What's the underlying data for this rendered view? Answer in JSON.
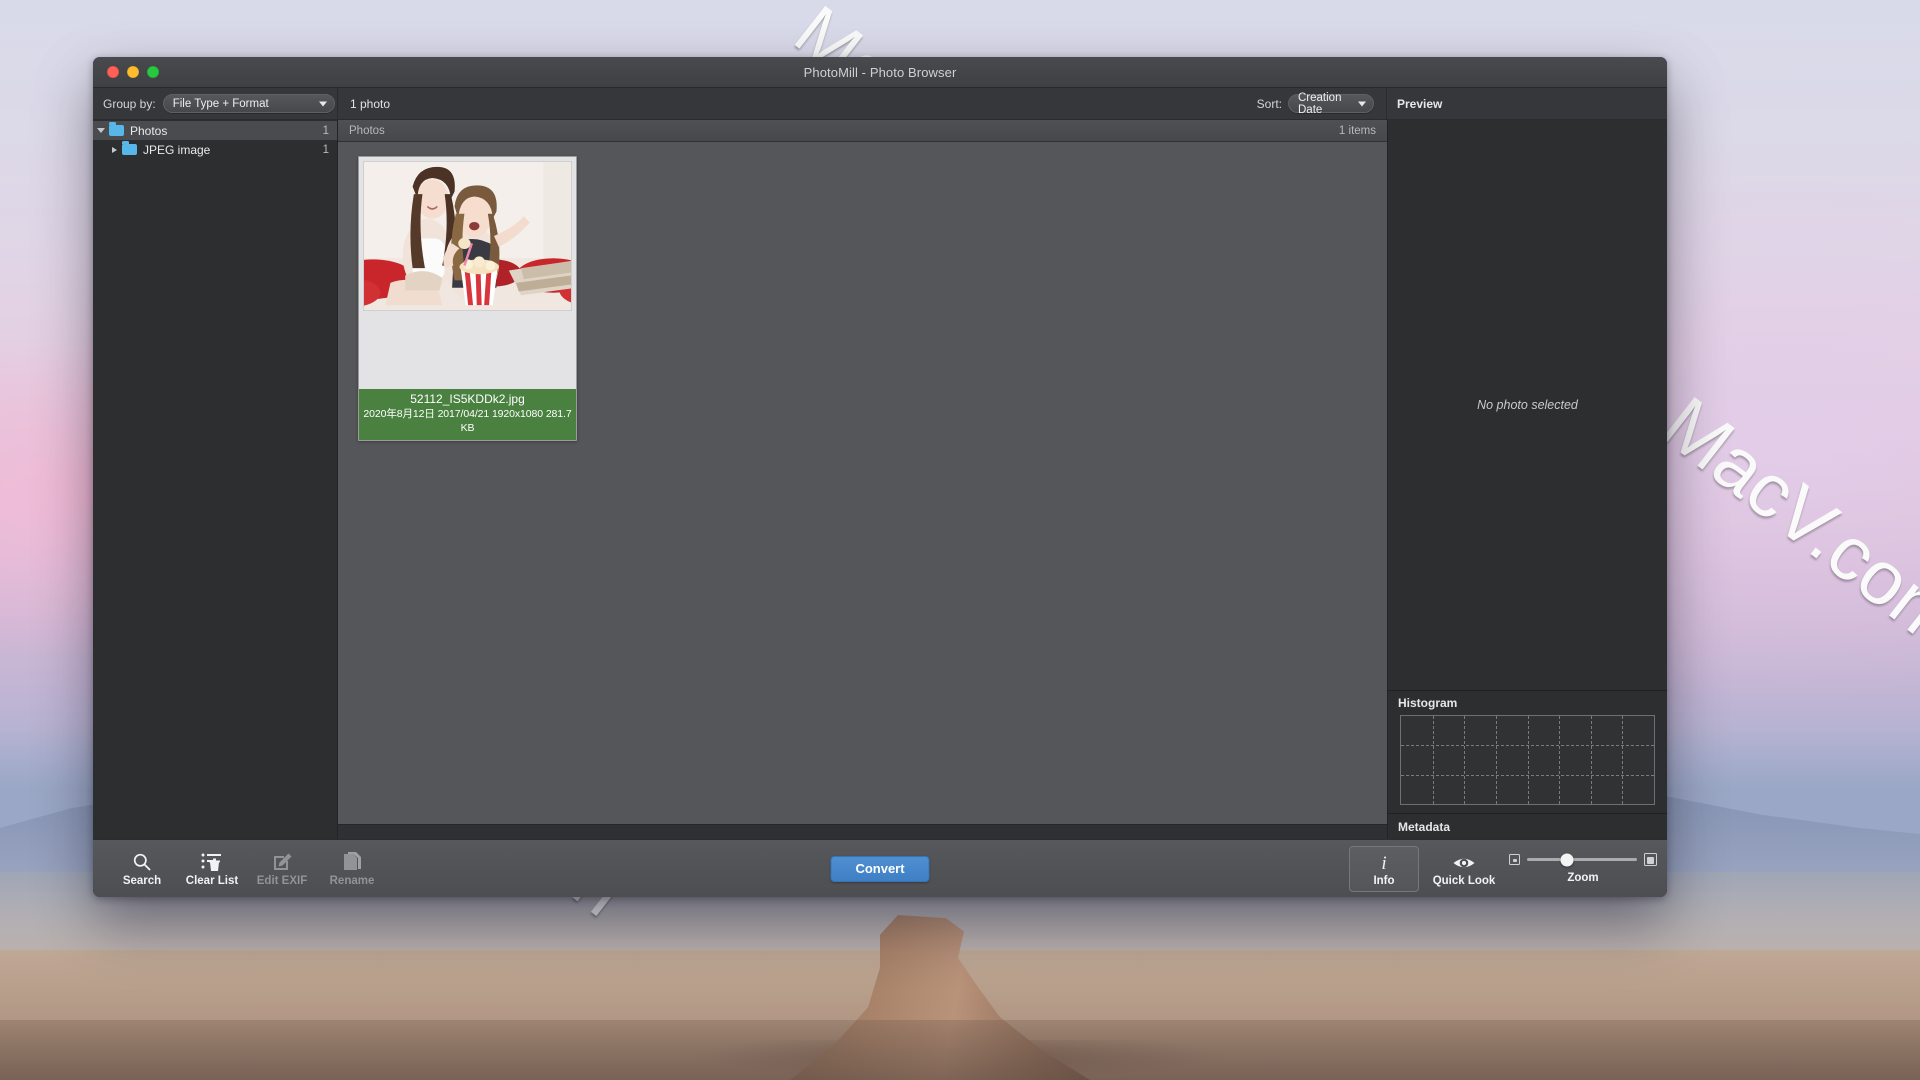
{
  "window": {
    "title": "PhotoMill - Photo Browser",
    "traffic_lights": [
      "close",
      "minimize",
      "zoom"
    ]
  },
  "toolbar_top": {
    "group_by_label": "Group by:",
    "group_by_value": "File Type + Format",
    "photo_count": "1 photo",
    "sort_label": "Sort:",
    "sort_value": "Creation Date",
    "preview_header": "Preview"
  },
  "sidebar": {
    "items": [
      {
        "label": "Photos",
        "count": "1",
        "level": 0,
        "expanded": true,
        "selected": true
      },
      {
        "label": "JPEG image",
        "count": "1",
        "level": 1,
        "expanded": false,
        "selected": false
      }
    ]
  },
  "content": {
    "header_left": "Photos",
    "header_right": "1 items",
    "thumbnails": [
      {
        "filename": "52112_IS5KDDk2.jpg",
        "meta_line": "2020年8月12日 2017/04/21  1920x1080  281.7 KB",
        "date_created": "2020年8月12日",
        "date_modified": "2017/04/21",
        "dimensions": "1920x1080",
        "filesize": "281.7 KB",
        "selected": true,
        "caption_color": "#4a8141"
      }
    ]
  },
  "inspector": {
    "preview_header": "Preview",
    "preview_empty_text": "No photo selected",
    "histogram_header": "Histogram",
    "histogram_columns": 8,
    "histogram_rows": 3,
    "metadata_header": "Metadata"
  },
  "toolbar_bottom": {
    "left_items": [
      {
        "label": "Search",
        "icon": "search-icon",
        "enabled": true
      },
      {
        "label": "Clear List",
        "icon": "clear-list-icon",
        "enabled": true
      },
      {
        "label": "Edit EXIF",
        "icon": "edit-exif-icon",
        "enabled": false
      },
      {
        "label": "Rename",
        "icon": "rename-icon",
        "enabled": false
      }
    ],
    "convert_label": "Convert",
    "right_items": [
      {
        "label": "Info",
        "icon": "info-icon",
        "active": true
      },
      {
        "label": "Quick Look",
        "icon": "eye-icon",
        "active": false
      }
    ],
    "zoom_label": "Zoom",
    "zoom_value": 36
  },
  "desktop": {
    "watermarks": [
      "MacV.com",
      "MacV.com",
      "MacV.com"
    ]
  },
  "colors": {
    "accent_button": "#4284c9",
    "caption_green": "#4a8141",
    "folder_blue": "#56b7e8",
    "window_chrome": "#3a3a3c",
    "sidebar_bg": "#2d2e30",
    "grid_bg": "#555659"
  }
}
